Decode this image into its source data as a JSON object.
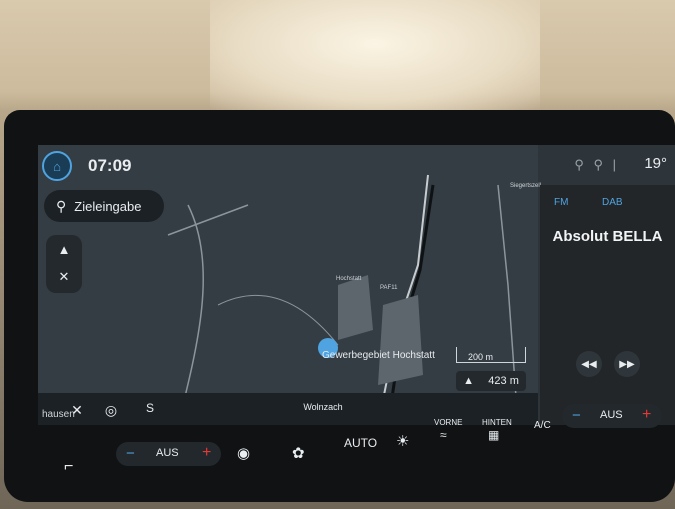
{
  "status": {
    "time": "07:09",
    "temperature": "19°"
  },
  "search": {
    "label": "Zieleingabe"
  },
  "map": {
    "places": [
      "Siegertszell",
      "Hochstatt",
      "PAF11"
    ],
    "location_name": "Gewerbegebiet Hochstatt",
    "scale": "200 m",
    "elevation": "423 m",
    "road": "Wolnzach",
    "bottom_left_text": "hausen",
    "compass_letter": "S"
  },
  "radio": {
    "source_fm": "FM",
    "source_dab": "DAB",
    "station": "Absolut BELLA"
  },
  "climate": {
    "left_fan": "AUS",
    "right_fan": "AUS",
    "auto": "AUTO",
    "front": "VORNE",
    "rear": "HINTEN",
    "ac": "A/C"
  }
}
